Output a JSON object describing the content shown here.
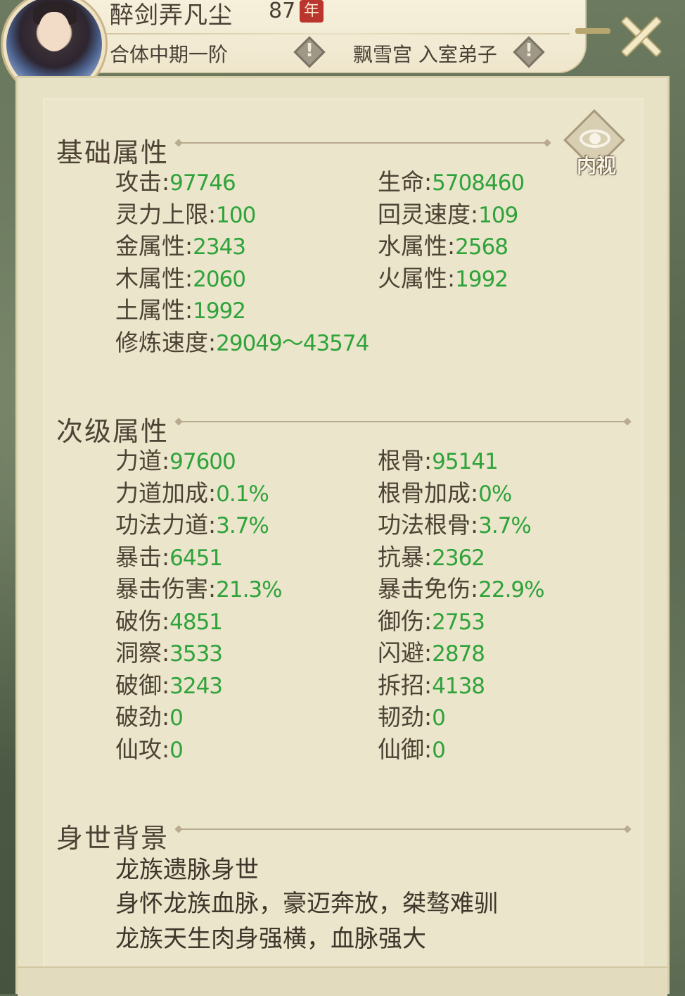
{
  "header": {
    "name": "醉剑弄凡尘",
    "age_value": "87",
    "age_unit": "年",
    "realm": "合体中期一阶",
    "sect": "飘雪宫 入室弟子",
    "warn_mark": "!"
  },
  "inspect_button": {
    "label": "内视"
  },
  "basic": {
    "title": "基础属性",
    "stats": [
      {
        "label": "攻击",
        "value": "97746"
      },
      {
        "label": "生命",
        "value": "5708460"
      },
      {
        "label": "灵力上限",
        "value": "100"
      },
      {
        "label": "回灵速度",
        "value": "109"
      },
      {
        "label": "金属性",
        "value": "2343"
      },
      {
        "label": "水属性",
        "value": "2568"
      },
      {
        "label": "木属性",
        "value": "2060"
      },
      {
        "label": "火属性",
        "value": "1992"
      },
      {
        "label": "土属性",
        "value": "1992"
      },
      {
        "label": "修炼速度",
        "value": "29049～43574"
      }
    ]
  },
  "secondary": {
    "title": "次级属性",
    "stats": [
      {
        "label": "力道",
        "value": "97600"
      },
      {
        "label": "根骨",
        "value": "95141"
      },
      {
        "label": "力道加成",
        "value": "0.1%"
      },
      {
        "label": "根骨加成",
        "value": "0%"
      },
      {
        "label": "功法力道",
        "value": "3.7%"
      },
      {
        "label": "功法根骨",
        "value": "3.7%"
      },
      {
        "label": "暴击",
        "value": "6451"
      },
      {
        "label": "抗暴",
        "value": "2362"
      },
      {
        "label": "暴击伤害",
        "value": "21.3%"
      },
      {
        "label": "暴击免伤",
        "value": "22.9%"
      },
      {
        "label": "破伤",
        "value": "4851"
      },
      {
        "label": "御伤",
        "value": "2753"
      },
      {
        "label": "洞察",
        "value": "3533"
      },
      {
        "label": "闪避",
        "value": "2878"
      },
      {
        "label": "破御",
        "value": "3243"
      },
      {
        "label": "拆招",
        "value": "4138"
      },
      {
        "label": "破劲",
        "value": "0"
      },
      {
        "label": "韧劲",
        "value": "0"
      },
      {
        "label": "仙攻",
        "value": "0"
      },
      {
        "label": "仙御",
        "value": "0"
      }
    ]
  },
  "background": {
    "title": "身世背景",
    "lines": [
      "龙族遗脉身世",
      "身怀龙族血脉，豪迈奔放，桀骜难驯",
      "龙族天生肉身强横，血脉强大"
    ]
  },
  "colors": {
    "value_green": "#2fa33a",
    "label_brown": "#4d4233",
    "panel_bg": "#e7e1c6",
    "age_badge": "#b9352d"
  }
}
